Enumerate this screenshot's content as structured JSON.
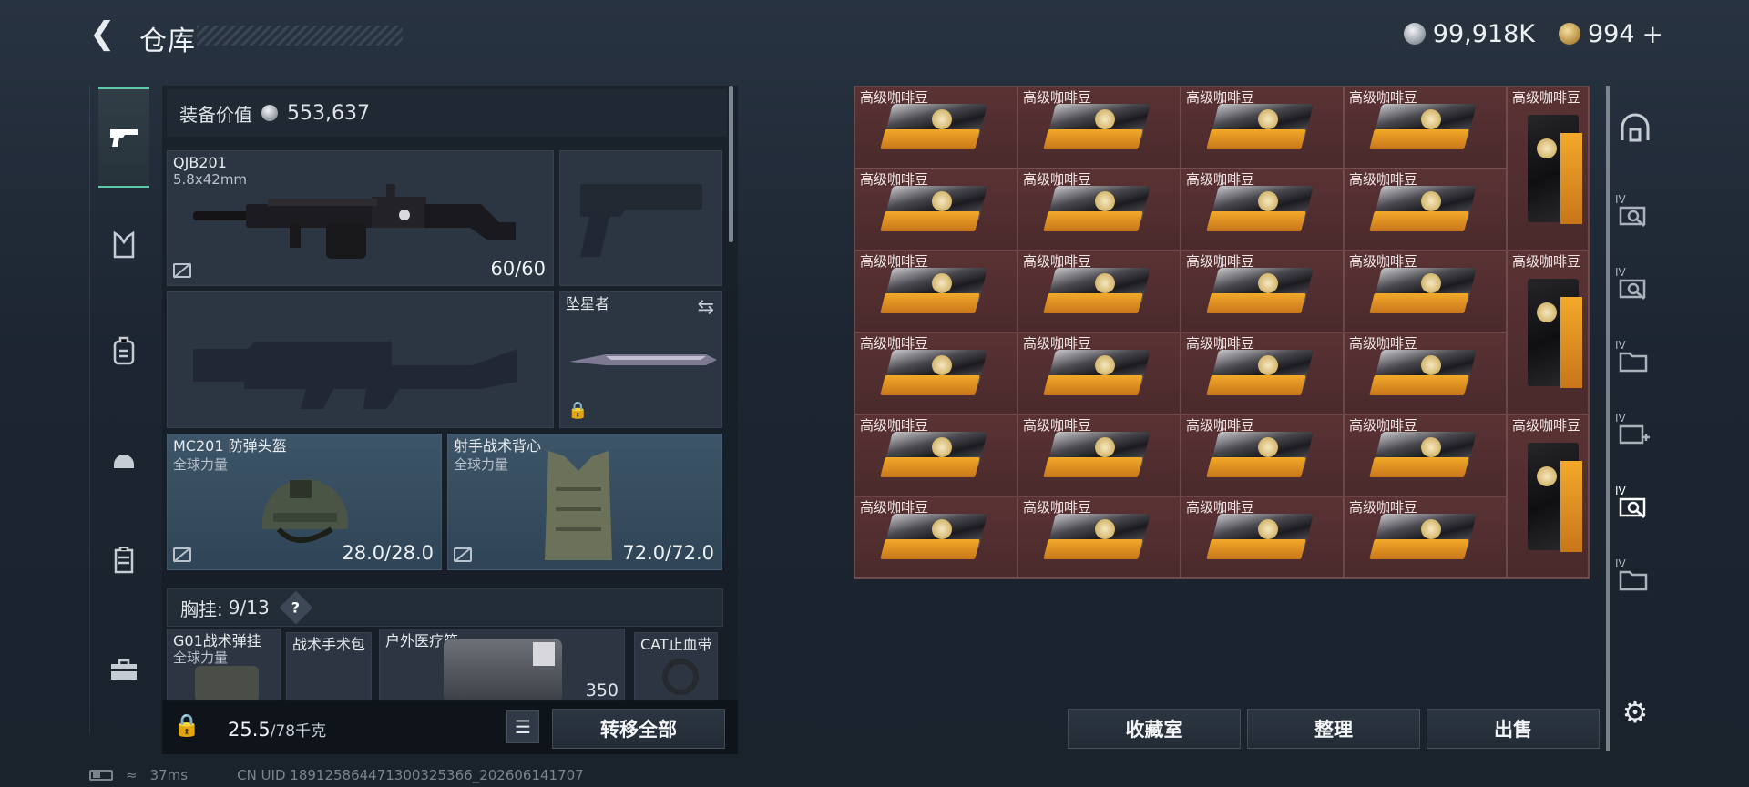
{
  "header": {
    "title": "仓库",
    "silver": "99,918K",
    "gold": "994",
    "plus": "+"
  },
  "left_nav": [
    "pistol-icon",
    "vest-icon",
    "backpack-icon",
    "rig-icon",
    "case-icon",
    "toolbox-icon"
  ],
  "equipment": {
    "value_label": "装备价值",
    "value": "553,637",
    "primary": {
      "name": "QJB201",
      "caliber": "5.8x42mm",
      "durability": "60/60"
    },
    "melee": {
      "name": "坠星者"
    },
    "helmet": {
      "name": "MC201 防弹头盔",
      "brand": "全球力量",
      "durability": "28.0/28.0"
    },
    "armor": {
      "name": "射手战术背心",
      "brand": "全球力量",
      "durability": "72.0/72.0"
    }
  },
  "rig": {
    "label": "胸挂:",
    "capacity": "9/13",
    "help": "?",
    "items": [
      {
        "name": "G01战术弹挂",
        "brand": "全球力量"
      },
      {
        "name": "战术手术包"
      },
      {
        "name": "户外医疗箱",
        "count": "350"
      },
      {
        "name": "CAT止血带"
      }
    ]
  },
  "footer": {
    "weight": "25.5",
    "weight_max": "/78千克",
    "transfer_all": "转移全部"
  },
  "stash": {
    "item_name": "高级咖啡豆",
    "actions": {
      "collection": "收藏室",
      "sort": "整理",
      "sell": "出售"
    }
  },
  "status": {
    "ping": "37ms",
    "uid": "CN UID 18912586447130032536​6_202606141707"
  }
}
